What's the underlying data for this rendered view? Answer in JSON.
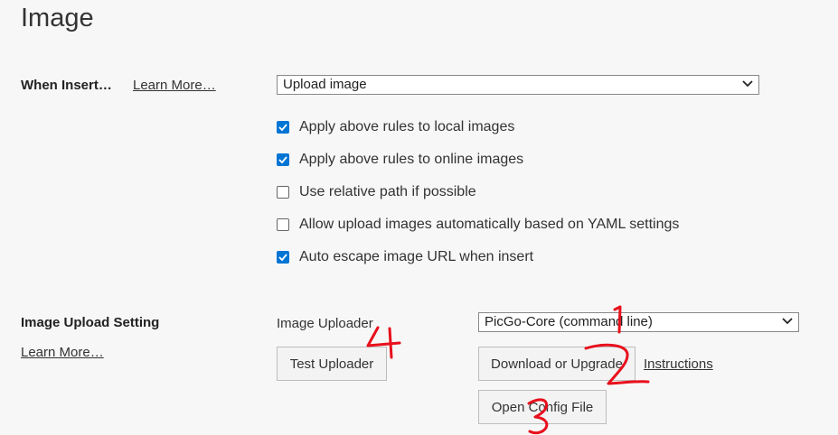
{
  "page": {
    "title": "Image"
  },
  "when_insert": {
    "label": "When Insert…",
    "learn_more": "Learn More…",
    "select_value": "Upload image",
    "options": [
      {
        "label": "Apply above rules to local images",
        "checked": true
      },
      {
        "label": "Apply above rules to online images",
        "checked": true
      },
      {
        "label": "Use relative path if possible",
        "checked": false
      },
      {
        "label": "Allow upload images automatically based on YAML settings",
        "checked": false
      },
      {
        "label": "Auto escape image URL when insert",
        "checked": true
      }
    ]
  },
  "upload_setting": {
    "label": "Image Upload Setting",
    "learn_more": "Learn More…",
    "uploader_label": "Image Uploader",
    "uploader_value": "PicGo-Core (command line)",
    "test_button": "Test Uploader",
    "download_button": "Download or Upgrade",
    "instructions_link": "Instructions",
    "open_config_button": "Open Config File"
  },
  "annotations": [
    "1",
    "2",
    "3",
    "4"
  ],
  "colors": {
    "accent": "#0075d4",
    "annotation": "#e8101c"
  }
}
